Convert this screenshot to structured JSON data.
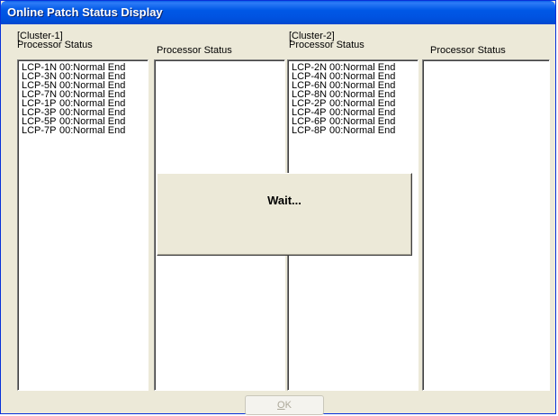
{
  "window": {
    "title": "Online Patch Status Display"
  },
  "clusters": [
    {
      "label": "[Cluster-1]",
      "columns": [
        {
          "header": "Processor  Status",
          "rows": [
            {
              "processor": "LCP-1N",
              "status": "00:Normal End"
            },
            {
              "processor": "LCP-3N",
              "status": "00:Normal End"
            },
            {
              "processor": "LCP-5N",
              "status": "00:Normal End"
            },
            {
              "processor": "LCP-7N",
              "status": "00:Normal End"
            },
            {
              "processor": "LCP-1P",
              "status": "00:Normal End"
            },
            {
              "processor": "LCP-3P",
              "status": "00:Normal End"
            },
            {
              "processor": "LCP-5P",
              "status": "00:Normal End"
            },
            {
              "processor": "LCP-7P",
              "status": "00:Normal End"
            }
          ]
        },
        {
          "header": "Processor  Status",
          "rows": []
        }
      ]
    },
    {
      "label": "[Cluster-2]",
      "columns": [
        {
          "header": "Processor  Status",
          "rows": [
            {
              "processor": "LCP-2N",
              "status": "00:Normal End"
            },
            {
              "processor": "LCP-4N",
              "status": "00:Normal End"
            },
            {
              "processor": "LCP-6N",
              "status": "00:Normal End"
            },
            {
              "processor": "LCP-8N",
              "status": "00:Normal End"
            },
            {
              "processor": "LCP-2P",
              "status": "00:Normal End"
            },
            {
              "processor": "LCP-4P",
              "status": "00:Normal End"
            },
            {
              "processor": "LCP-6P",
              "status": "00:Normal End"
            },
            {
              "processor": "LCP-8P",
              "status": "00:Normal End"
            }
          ]
        },
        {
          "header": "Processor  Status",
          "rows": []
        }
      ]
    }
  ],
  "wait_panel": {
    "message": "Wait..."
  },
  "buttons": {
    "ok_label_underlined": "O",
    "ok_label_rest": "K",
    "ok_enabled": false
  }
}
